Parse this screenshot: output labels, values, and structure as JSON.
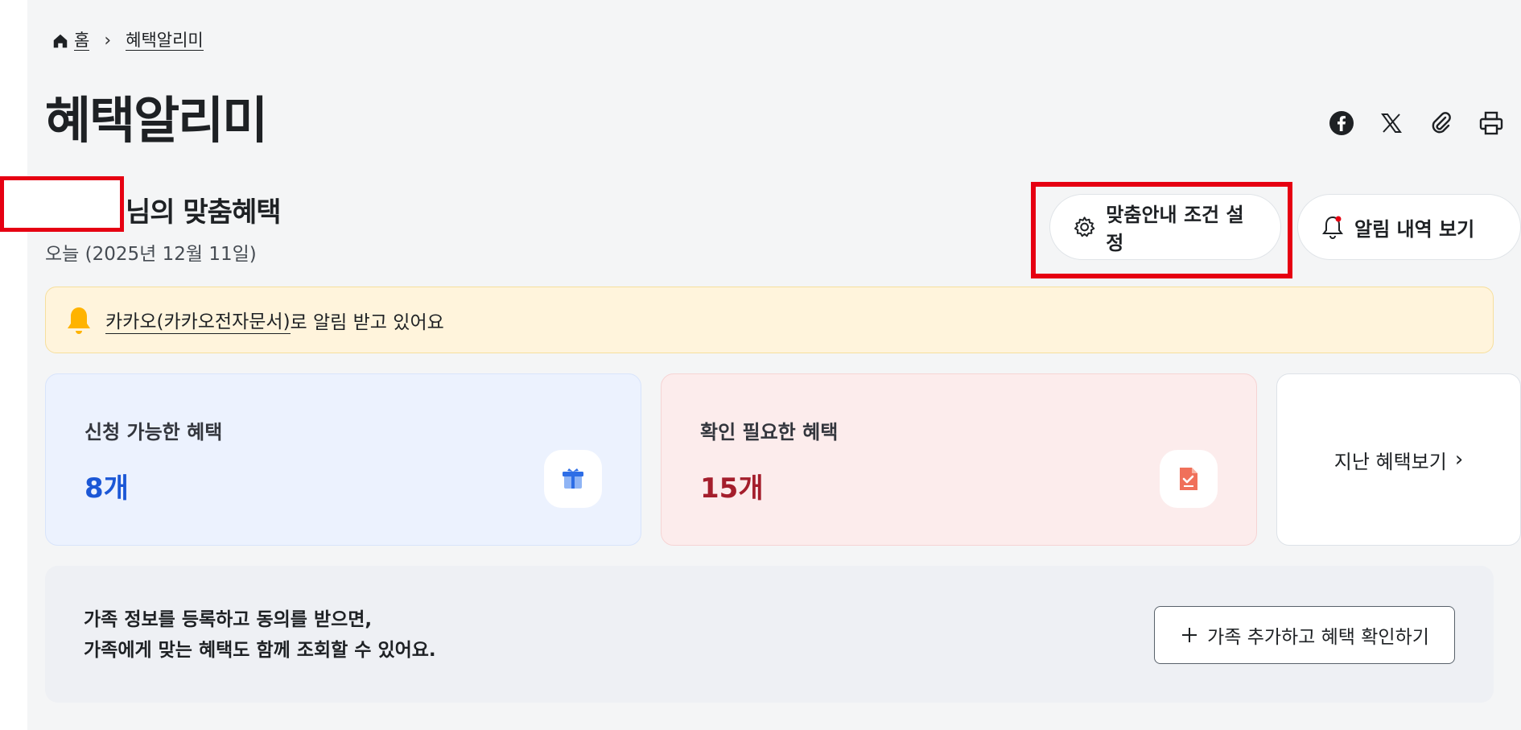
{
  "breadcrumb": {
    "home": "홈",
    "current": "혜택알리미"
  },
  "page_title": "혜택알리미",
  "share": {
    "icons": [
      "facebook-icon",
      "x-icon",
      "link-icon",
      "print-icon"
    ]
  },
  "user": {
    "heading_suffix": "님의 맞춤혜택",
    "today": "오늘 (2025년 12월 11일)"
  },
  "buttons": {
    "settings": "맞춤안내 조건 설정",
    "history": "알림 내역 보기"
  },
  "alert": {
    "link": "카카오(카카오전자문서)",
    "rest": "로 알림 받고 있어요"
  },
  "cards": {
    "available": {
      "label": "신청 가능한 혜택",
      "count": "8개"
    },
    "check": {
      "label": "확인 필요한 혜택",
      "count": "15개"
    },
    "past": {
      "label": "지난 혜택보기"
    }
  },
  "family": {
    "line1": "가족 정보를 등록하고 동의를 받으면,",
    "line2": "가족에게 맞는 혜택도 함께 조회할 수 있어요.",
    "button": "가족 추가하고 혜택 확인하기"
  },
  "colors": {
    "available": "#1b57d6",
    "check": "#a41e2c",
    "highlight": "#e60012",
    "alert_bg": "#fff4dc"
  }
}
